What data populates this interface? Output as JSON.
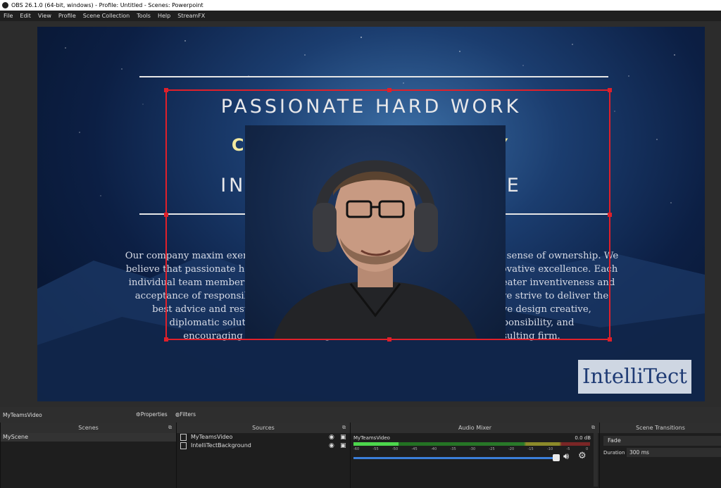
{
  "window": {
    "title": "OBS 26.1.0 (64-bit, windows) - Profile: Untitled - Scenes: Powerpoint"
  },
  "menu": [
    "File",
    "Edit",
    "View",
    "Profile",
    "Scene Collection",
    "Tools",
    "Help",
    "StreamFX"
  ],
  "slide": {
    "line1": "PASSIONATE HARD WORK",
    "line2": "COURAGEOUS HONESTY",
    "line3": "INNOVATIVE EXCELLENCE",
    "paragraph_lines": [
      "Our company maxim exemplifies what drives us and gives each team member a sense of ownership. We",
      "believe that passionate hard work paired with courageous honesty leads to innovative excellence. Each",
      "individual team member operates with a certain autonomy which allows for greater inventiveness and",
      "acceptance of responsibility. We're passionate about quality and that means we strive to deliver the",
      "best advice and results, not for ourselves but to solve difficult problems, we design creative,",
      "diplomatic solutions tailored to fit. We foster a culture of freedom, responsibility, and",
      "encouraging innovation through our software architecture and consulting firm."
    ],
    "logo": "IntelliTect"
  },
  "source_toolbar": {
    "selected_source": "MyTeamsVideo",
    "properties_label": "Properties",
    "filters_label": "Filters"
  },
  "scenes": {
    "header": "Scenes",
    "items": [
      "MyScene"
    ]
  },
  "sources": {
    "header": "Sources",
    "items": [
      "MyTeamsVideo",
      "IntelliTectBackground"
    ]
  },
  "audio_mixer": {
    "header": "Audio Mixer",
    "channel_name": "MyTeamsVideo",
    "db": "0.0 dB",
    "level": 0.19,
    "volume": 1.0,
    "scale": [
      "-60",
      "-55",
      "-50",
      "-45",
      "-40",
      "-35",
      "-30",
      "-25",
      "-20",
      "-15",
      "-10",
      "-5",
      "0"
    ]
  },
  "transitions": {
    "header": "Scene Transitions",
    "selected": "Fade",
    "duration_label": "Duration",
    "duration_value": "300 ms"
  }
}
